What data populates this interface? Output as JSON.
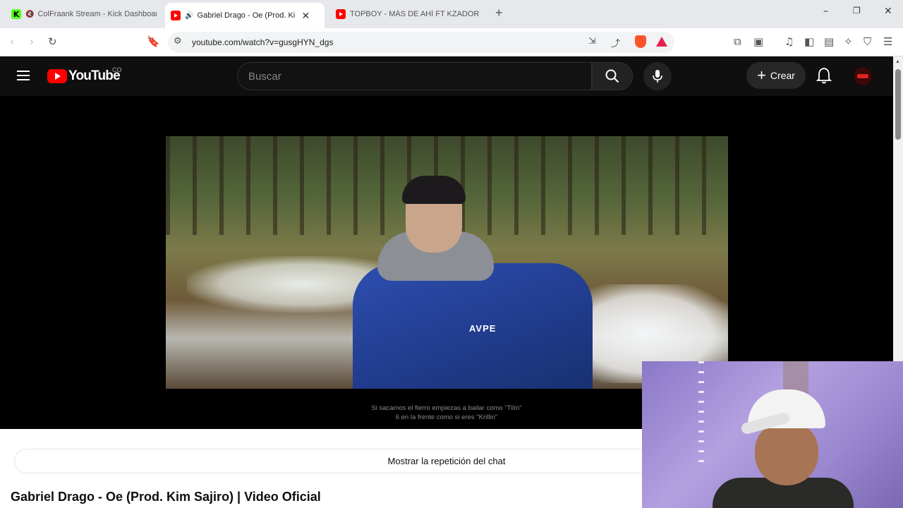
{
  "browser": {
    "tabs": [
      {
        "label": "ColFraank Stream - Kick Dashboard",
        "favicon": "kick-icon"
      },
      {
        "label": "Gabriel Drago - Oe (Prod. Kim Sajiro)",
        "favicon": "youtube-icon",
        "active": true,
        "audio": "speaker-icon"
      },
      {
        "label": "TOPBOY - MÁS DE AHÍ FT KZADORES",
        "favicon": "youtube-icon"
      }
    ],
    "url": "youtube.com/watch?v=gusgHYN_dgs"
  },
  "youtube": {
    "logo_text": "YouTube",
    "country_code": "CO",
    "search_placeholder": "Buscar",
    "create_label": "Crear"
  },
  "player": {
    "subtitle_lines": [
      "Si sacamos el fierro empiezas a bailar como \"Tilín\"",
      "6 en la frente como si eres \"Krillin\""
    ],
    "shirt_text": "AVPE"
  },
  "below": {
    "chat_replay_label": "Mostrar la repetición del chat",
    "video_title": "Gabriel Drago - Oe (Prod. Kim Sajiro) | Video Oficial"
  },
  "colors": {
    "youtube_red": "#ff0000",
    "header_bg": "#0f0f0f",
    "kick_green": "#53fc18"
  }
}
